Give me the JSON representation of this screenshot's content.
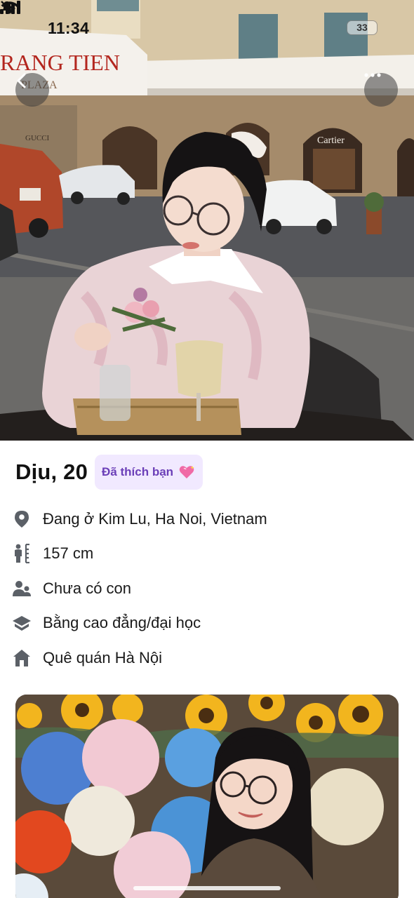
{
  "status_bar": {
    "time": "11:34",
    "battery": "33"
  },
  "hero": {
    "shop_sign": "RANG TIEN",
    "shop_sign_sub": "PLAZA",
    "brand_gucci": "GUCCI",
    "brand_cartier": "Cartier"
  },
  "profile": {
    "name_age": "Dịu, 20",
    "liked_badge": "Đã thích bạn",
    "details": [
      {
        "icon": "location-pin-icon",
        "text": "Đang ở Kim Lu, Ha Noi, Vietnam"
      },
      {
        "icon": "height-icon",
        "text": "157 cm"
      },
      {
        "icon": "children-icon",
        "text": "Chưa có con"
      },
      {
        "icon": "education-icon",
        "text": "Bằng cao đẳng/đại học"
      },
      {
        "icon": "hometown-icon",
        "text": "Quê quán Hà Nội"
      }
    ]
  },
  "colors": {
    "badge_bg": "#f1e9ff",
    "badge_text": "#6b3fb8",
    "icon_gray": "#5b6067"
  }
}
